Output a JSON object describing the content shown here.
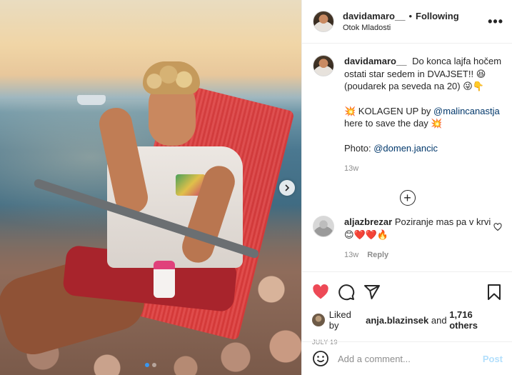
{
  "post": {
    "author": "davidamaro__",
    "bullet": "•",
    "follow_status": "Following",
    "location": "Otok Mladosti",
    "more_glyph": "•••"
  },
  "caption": {
    "username": "davidamaro__",
    "line1": "Do konca lajfa hočem ostati star sedem in DVAJSET!! 😆 (poudarek pa seveda na 20) 😜👇",
    "line2_prefix": "💥 KOLAGEN UP by ",
    "line2_mention": "@malincanastja",
    "line2_suffix": " here to save the day 💥",
    "photo_prefix": "Photo: ",
    "photo_mention": "@domen.jancic",
    "time": "13w"
  },
  "load_more_glyph": "+",
  "comments": [
    {
      "username": "aljazbrezar",
      "text": "Poziranje mas pa v krvi",
      "emojis": "😊❤️❤️🔥",
      "time": "13w",
      "reply_label": "Reply"
    }
  ],
  "likes": {
    "prefix": "Liked by ",
    "user": "anja.blazinsek",
    "middle": " and ",
    "others": "1,716 others"
  },
  "date": "JULY 19",
  "add_comment": {
    "placeholder": "Add a comment...",
    "post_label": "Post"
  },
  "carousel": {
    "slides": 2,
    "active_slide": 1
  },
  "colors": {
    "like_red": "#ed4956",
    "link_blue": "#00376b",
    "post_disabled": "#b2dffc",
    "carousel_dot_active": "#3897f0"
  },
  "icons": [
    "heart-icon",
    "comment-icon",
    "share-icon",
    "bookmark-icon",
    "smiley-icon",
    "plus-circle-icon",
    "chevron-right-icon",
    "more-horizontal-icon"
  ]
}
